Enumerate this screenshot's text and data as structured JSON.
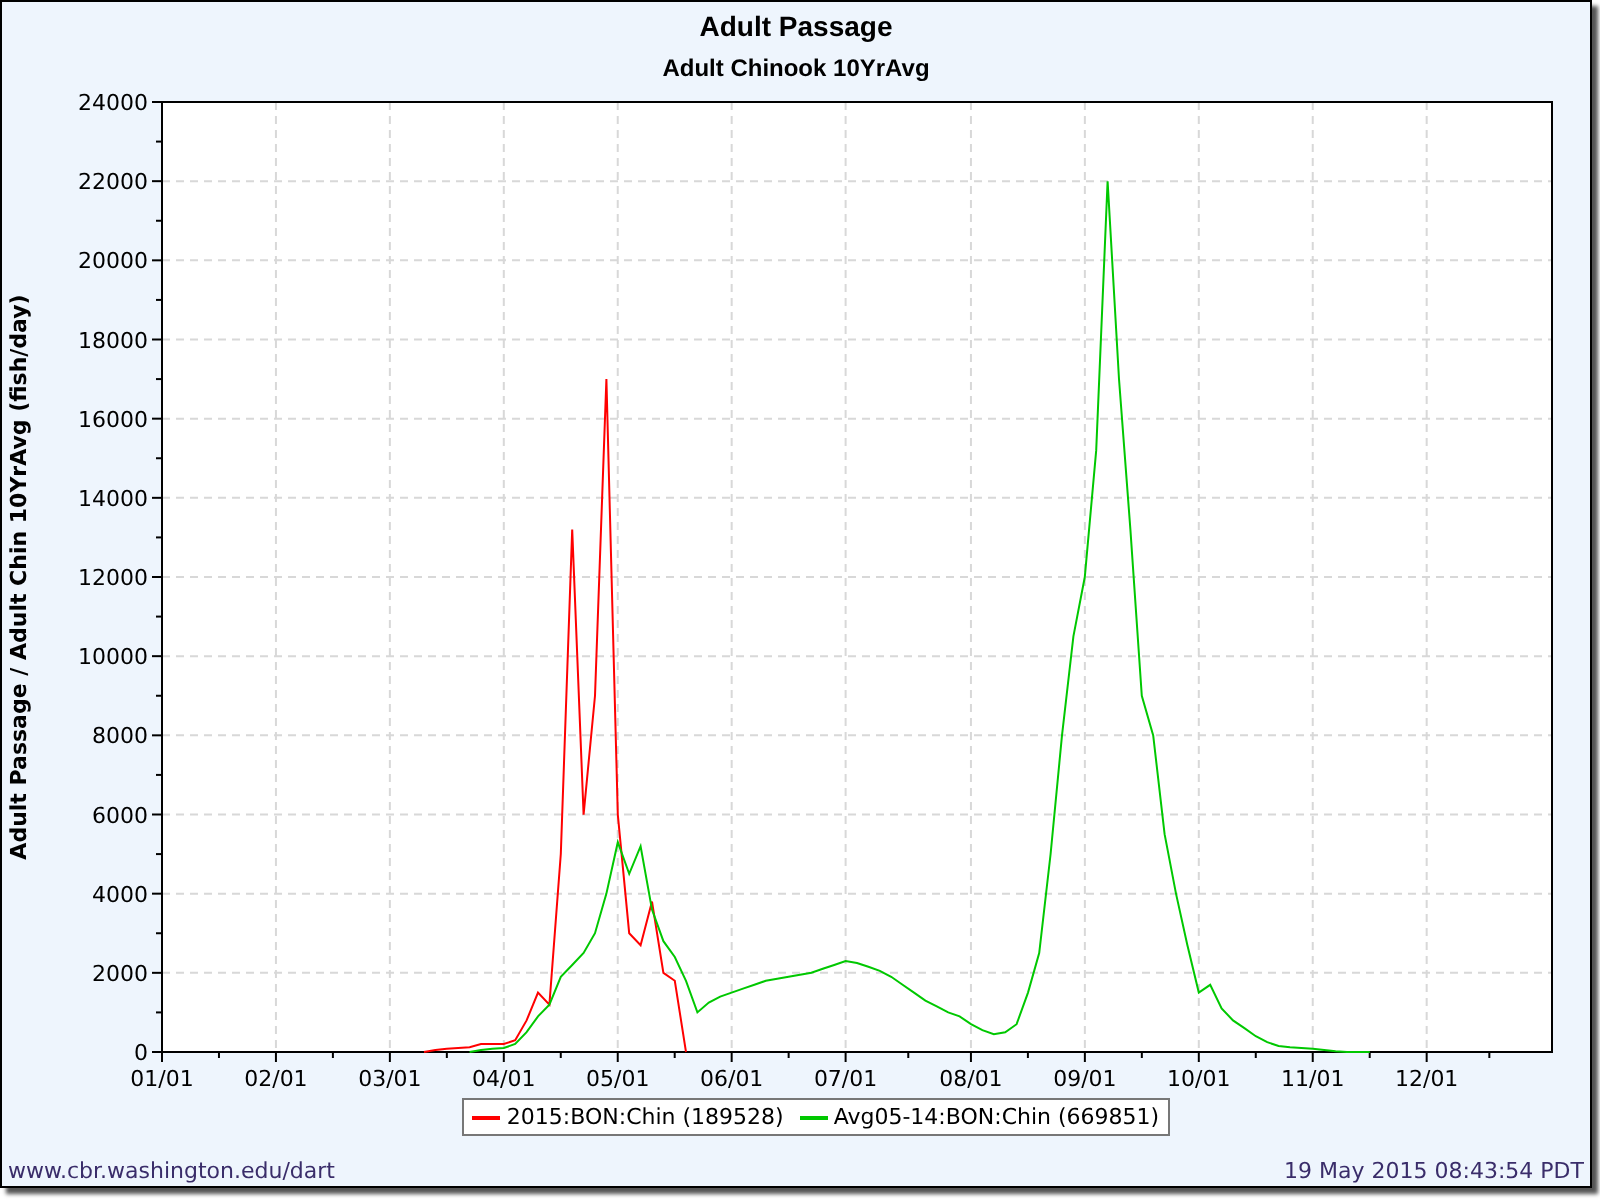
{
  "title": "Adult Passage",
  "subtitle": "Adult Chinook 10YrAvg",
  "chart_data": {
    "type": "line",
    "ylabel": "Adult Passage / Adult Chin 10YrAvg (fish/day)",
    "categories": [
      "01/01",
      null,
      null,
      null,
      null,
      null,
      null,
      null,
      null,
      null,
      "02/01",
      null,
      null,
      null,
      null,
      null,
      null,
      null,
      null,
      null,
      "03/01",
      null,
      null,
      null,
      null,
      null,
      null,
      null,
      null,
      null,
      "04/01",
      null,
      null,
      null,
      null,
      null,
      null,
      null,
      null,
      null,
      "05/01",
      null,
      null,
      null,
      null,
      null,
      null,
      null,
      null,
      null,
      "06/01",
      null,
      null,
      null,
      null,
      null,
      null,
      null,
      null,
      null,
      "07/01",
      null,
      null,
      null,
      null,
      null,
      null,
      null,
      null,
      null,
      null,
      "08/01",
      null,
      null,
      null,
      null,
      null,
      null,
      null,
      null,
      null,
      "09/01",
      null,
      null,
      null,
      null,
      null,
      null,
      null,
      null,
      null,
      "10/01",
      null,
      null,
      null,
      null,
      null,
      null,
      null,
      null,
      null,
      "11/01",
      null,
      null,
      null,
      null,
      null,
      null,
      null,
      null,
      null,
      "12/01",
      null,
      null,
      null,
      null,
      null,
      null,
      null,
      null,
      null,
      null
    ],
    "series": [
      {
        "name": "2015:BON:Chin (189528)",
        "color": "#ff0000",
        "values": [
          null,
          null,
          null,
          null,
          null,
          null,
          null,
          null,
          null,
          null,
          null,
          null,
          null,
          null,
          null,
          null,
          null,
          null,
          null,
          null,
          null,
          null,
          null,
          0,
          50,
          80,
          100,
          120,
          200,
          200,
          200,
          300,
          800,
          1500,
          1200,
          5000,
          13200,
          6000,
          9000,
          17000,
          6000,
          3000,
          2700,
          3800,
          2000,
          1800,
          0,
          null,
          null,
          null,
          null,
          null,
          null,
          null,
          null,
          null,
          null,
          null,
          null,
          null,
          null,
          null,
          null,
          null,
          null,
          null,
          null,
          null,
          null,
          null,
          null,
          null,
          null,
          null,
          null,
          null,
          null,
          null,
          null,
          null,
          null,
          null,
          null,
          null,
          null,
          null,
          null,
          null,
          null,
          null,
          null,
          null,
          null,
          null,
          null,
          null,
          null,
          null,
          null,
          null,
          null,
          null,
          null,
          null,
          null,
          null,
          null,
          null,
          null,
          null,
          null,
          null,
          null,
          null,
          null,
          null,
          null,
          null,
          null,
          null,
          null,
          null
        ]
      },
      {
        "name": "Avg05-14:BON:Chin (669851)",
        "color": "#00c800",
        "values": [
          null,
          null,
          null,
          null,
          null,
          null,
          null,
          null,
          null,
          null,
          null,
          null,
          null,
          null,
          null,
          null,
          null,
          null,
          null,
          null,
          null,
          null,
          null,
          null,
          null,
          null,
          null,
          0,
          50,
          80,
          100,
          200,
          500,
          900,
          1200,
          1900,
          2200,
          2500,
          3000,
          4000,
          5300,
          4500,
          5200,
          3600,
          2800,
          2400,
          1800,
          1000,
          1250,
          1400,
          1500,
          1600,
          1700,
          1800,
          1850,
          1900,
          1950,
          2000,
          2100,
          2200,
          2300,
          2250,
          2150,
          2050,
          1900,
          1700,
          1500,
          1300,
          1150,
          1000,
          900,
          700,
          550,
          450,
          500,
          700,
          1500,
          2500,
          5000,
          8000,
          10500,
          12000,
          15200,
          22000,
          17000,
          13200,
          9000,
          8000,
          5500,
          4000,
          2700,
          1500,
          1700,
          1100,
          800,
          600,
          400,
          250,
          150,
          120,
          100,
          80,
          50,
          20,
          0,
          0,
          0,
          null,
          null,
          null,
          null,
          null,
          null,
          null,
          null,
          null,
          null,
          null,
          null,
          null,
          null,
          null
        ]
      }
    ],
    "grid": true,
    "ylim": [
      0,
      24000
    ],
    "yticks": [
      0,
      2000,
      4000,
      6000,
      8000,
      10000,
      12000,
      14000,
      16000,
      18000,
      20000,
      22000,
      24000
    ]
  },
  "footer": {
    "link": "www.cbr.washington.edu/dart",
    "timestamp": "19 May 2015 08:43:54 PDT"
  }
}
